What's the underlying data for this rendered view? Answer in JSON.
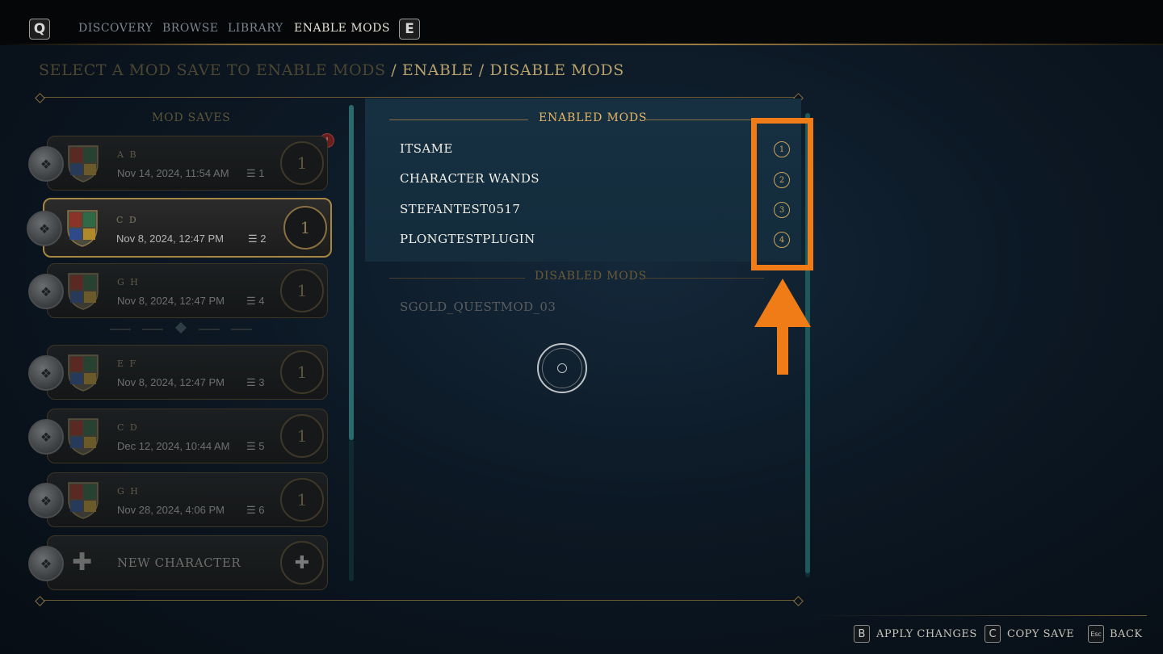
{
  "topbar": {
    "left_key": "Q",
    "right_key": "E",
    "tabs": [
      {
        "label": "DISCOVERY",
        "active": false
      },
      {
        "label": "BROWSE",
        "active": false
      },
      {
        "label": "LIBRARY",
        "active": false
      },
      {
        "label": "ENABLE MODS",
        "active": true
      }
    ]
  },
  "breadcrumb": {
    "part1": "SELECT A MOD SAVE TO ENABLE MODS",
    "part2": " / ENABLE / DISABLE MODS"
  },
  "mod_saves": {
    "title": "MOD SAVES",
    "notification": "!",
    "cards": [
      {
        "initials": "A B",
        "date": "Nov 14, 2024, 11:54 AM",
        "count": "1",
        "level": "1",
        "selected": false
      },
      {
        "initials": "C D",
        "date": "Nov 8, 2024, 12:47 PM",
        "count": "2",
        "level": "1",
        "selected": true
      },
      {
        "initials": "G H",
        "date": "Nov 8, 2024, 12:47 PM",
        "count": "4",
        "level": "1",
        "selected": false
      },
      {
        "initials": "E F",
        "date": "Nov 8, 2024, 12:47 PM",
        "count": "3",
        "level": "1",
        "selected": false
      },
      {
        "initials": "C D",
        "date": "Dec 12, 2024, 10:44 AM",
        "count": "5",
        "level": "1",
        "selected": false
      },
      {
        "initials": "G H",
        "date": "Nov 28, 2024, 4:06 PM",
        "count": "6",
        "level": "1",
        "selected": false
      }
    ],
    "new_character_label": "NEW CHARACTER"
  },
  "enabled_mods": {
    "title": "ENABLED MODS",
    "items": [
      {
        "name": "ITSAME",
        "order": "1"
      },
      {
        "name": "CHARACTER WANDS",
        "order": "2"
      },
      {
        "name": "STEFANTEST0517",
        "order": "3"
      },
      {
        "name": "PLONGTESTPLUGIN",
        "order": "4"
      }
    ]
  },
  "disabled_mods": {
    "title": "DISABLED MODS",
    "items": [
      {
        "name": "SGOLD_QUESTMOD_03"
      }
    ]
  },
  "footer": {
    "hints": [
      {
        "key": "B",
        "label": "APPLY CHANGES"
      },
      {
        "key": "C",
        "label": "COPY SAVE"
      },
      {
        "key": "Esc",
        "label": "BACK"
      }
    ]
  },
  "colors": {
    "accent_gold": "#c9a45a",
    "highlight_orange": "#f07c18",
    "panel_blue": "#163042"
  }
}
